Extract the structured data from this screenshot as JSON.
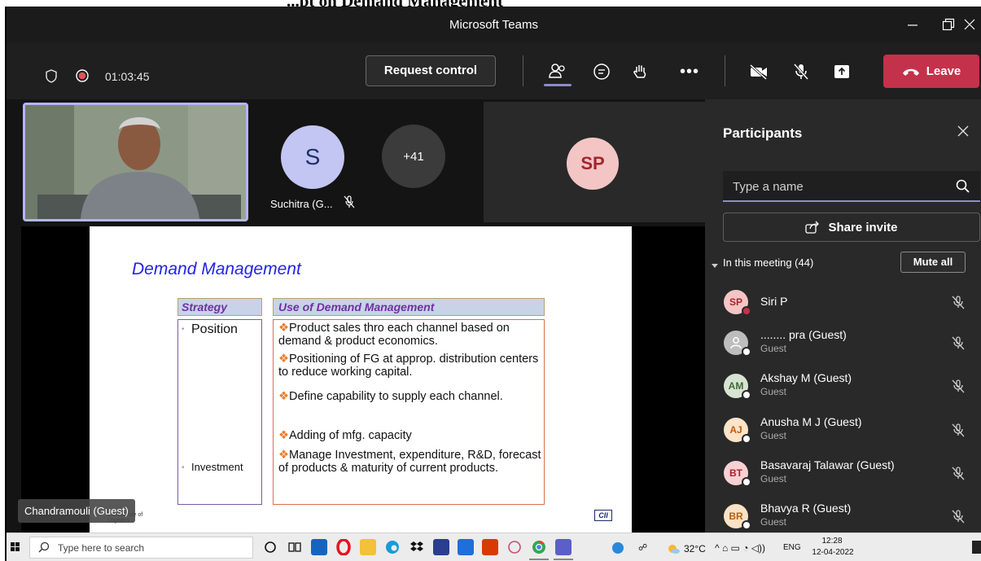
{
  "document_header": {
    "title": "...pt on Demand Management"
  },
  "window": {
    "title": "Microsoft Teams"
  },
  "toolbar": {
    "timer": "01:03:45",
    "request_control_label": "Request control",
    "leave_label": "Leave"
  },
  "tiles": {
    "suchitra_initial": "S",
    "suchitra_name": "Suchitra (G...",
    "overflow_count": "+41",
    "sp_initials": "SP"
  },
  "slide": {
    "title": "Demand Management",
    "col_strategy": "Strategy",
    "col_use": "Use of Demand Management",
    "row1_strategy": "Position",
    "row1_bullets": [
      "Product sales thro each channel based on demand & product economics.",
      "Positioning of FG at approp. distribution centers to reduce  working capital.",
      "Define capability to supply each channel."
    ],
    "row2_strategy": "Investment",
    "row2_bullets": [
      "Adding of mfg. capacity",
      "Manage Investment, expenditure, R&D, forecast of products & maturity of current products."
    ],
    "footer_logo_left": "CII Institute of Logistics",
    "footer_logo_right": "CII"
  },
  "presenter_label": "Chandramouli (Guest)",
  "panel": {
    "title": "Participants",
    "search_placeholder": "Type a name",
    "share_invite_label": "Share invite",
    "meeting_header": "In this meeting (44)",
    "mute_all_label": "Mute all",
    "participants": [
      {
        "initials": "SP",
        "name": "Siri P",
        "role": "",
        "avatar_bg": "#f4c5c5",
        "avatar_fg": "#a4262c",
        "status_color": "#c4314b"
      },
      {
        "initials": "",
        "name": "........ pra (Guest)",
        "role": "Guest",
        "avatar_bg": "#bdbdbd",
        "avatar_fg": "#ffffff",
        "status_color": "#ffffff"
      },
      {
        "initials": "AM",
        "name": "Akshay M (Guest)",
        "role": "Guest",
        "avatar_bg": "#d7e4d2",
        "avatar_fg": "#3e6b34",
        "status_color": "#ffffff"
      },
      {
        "initials": "AJ",
        "name": "Anusha M J (Guest)",
        "role": "Guest",
        "avatar_bg": "#fde3c7",
        "avatar_fg": "#c45a0b",
        "status_color": "#ffffff"
      },
      {
        "initials": "BT",
        "name": "Basavaraj Talawar (Guest)",
        "role": "Guest",
        "avatar_bg": "#f8d1d4",
        "avatar_fg": "#a4262c",
        "status_color": "#ffffff"
      },
      {
        "initials": "BR",
        "name": "Bhavya R (Guest)",
        "role": "Guest",
        "avatar_bg": "#fbe2c4",
        "avatar_fg": "#b5610d",
        "status_color": "#ffffff"
      }
    ]
  },
  "taskbar": {
    "search_placeholder": "Type here to search",
    "temperature": "32°C",
    "language": "ENG",
    "time": "12:28",
    "date": "12-04-2022"
  },
  "colors": {
    "teams_dark": "#1f1f1f",
    "leave_red": "#c4314b",
    "accent_purple": "#8b8cc7",
    "slide_title_blue": "#2323e6",
    "slide_purple": "#7030a0",
    "bullet_orange": "#e87c2b"
  }
}
